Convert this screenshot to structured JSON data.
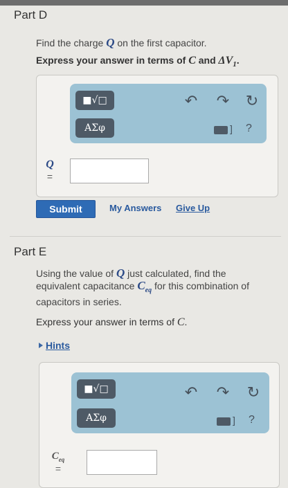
{
  "partD": {
    "title": "Part D",
    "question_prefix": "Find the charge",
    "question_var": "Q",
    "question_suffix": "on the first capacitor.",
    "express_prefix": "Express your answer in terms of",
    "express_var1": "C",
    "express_and": "and",
    "express_var2": "ΔV",
    "express_sub": "1",
    "express_end": ".",
    "toolbar": {
      "template_btn": "■√□",
      "symbol_btn": "ΑΣφ",
      "undo": "↶",
      "redo": "↷",
      "reset": "↻",
      "help": "?"
    },
    "input_label_var": "Q",
    "input_label_eq": "=",
    "input_value": "",
    "submit": "Submit",
    "my_answers": "My Answers",
    "give_up": "Give Up"
  },
  "partE": {
    "title": "Part E",
    "question_line1_prefix": "Using the value of",
    "question_line1_var": "Q",
    "question_line1_suffix": "just calculated, find the",
    "question_line2_prefix": "equivalent capacitance",
    "question_line2_var": "C",
    "question_line2_sub": "eq",
    "question_line2_suffix": "for this combination of",
    "question_line3": "capacitors in series.",
    "express_prefix": "Express your answer in terms of",
    "express_var": "C",
    "express_end": ".",
    "hints": "Hints",
    "toolbar": {
      "template_btn": "■√□",
      "symbol_btn": "ΑΣφ",
      "undo": "↶",
      "redo": "↷",
      "reset": "↻",
      "help": "?"
    },
    "input_label_var": "C",
    "input_label_sub": "eq",
    "input_label_eq": "=",
    "input_value": ""
  }
}
